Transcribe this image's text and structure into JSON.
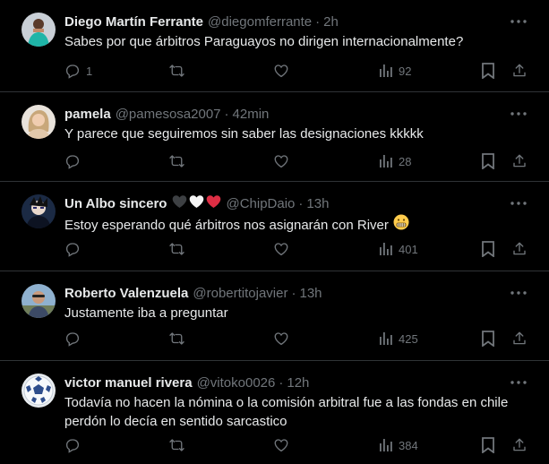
{
  "tweets": [
    {
      "name": "Diego Martín Ferrante",
      "handle": "@diegomferrante",
      "time": "2h",
      "text": [
        "Sabes por que árbitros Paraguayos no dirigen internacionalmente?"
      ],
      "replies": "1",
      "views": "92",
      "avatar": "avatar-teal-shirt"
    },
    {
      "name": "pamela",
      "handle": "@pamesosa2007",
      "time": "42min",
      "text": [
        "Y parece que seguiremos sin saber las designaciones kkkkk"
      ],
      "replies": "",
      "views": "28",
      "avatar": "avatar-blonde-woman"
    },
    {
      "name": "Un Albo sincero",
      "name_emojis": [
        "black-heart",
        "white-heart",
        "red-heart"
      ],
      "handle": "@ChipDaio",
      "time": "13h",
      "text": [
        "Estoy esperando qué árbitros nos asignarán con River"
      ],
      "text_emoji": "grimacing-face",
      "replies": "",
      "views": "401",
      "avatar": "avatar-anime-dark"
    },
    {
      "name": "Roberto Valenzuela",
      "handle": "@robertitojavier",
      "time": "13h",
      "text": [
        "Justamente iba a preguntar"
      ],
      "replies": "",
      "views": "425",
      "avatar": "avatar-man-outdoors"
    },
    {
      "name": "victor manuel rivera",
      "handle": "@vitoko0026",
      "time": "12h",
      "text": [
        "Todavía no hacen la nómina o la comisión arbitral fue a las fondas en chile",
        "perdón lo decía en sentido sarcastico"
      ],
      "replies": "",
      "views": "384",
      "avatar": "avatar-soccer-ball"
    }
  ],
  "separator": "·",
  "colors": {
    "background": "#000000",
    "text": "#e7e9ea",
    "secondary": "#71767b",
    "divider": "#2f3336",
    "red_heart": "#f91880"
  }
}
